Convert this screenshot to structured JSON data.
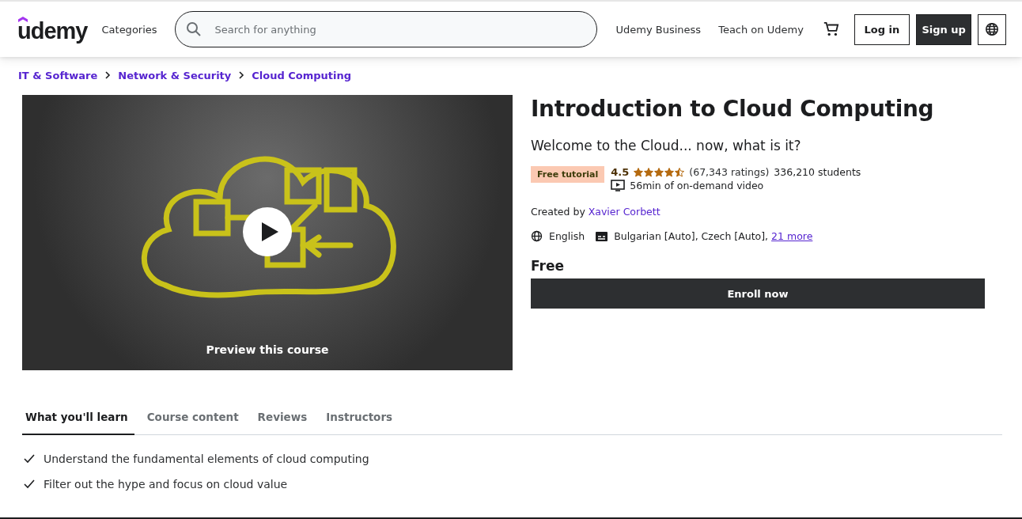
{
  "header": {
    "logo": "udemy",
    "categories": "Categories",
    "search": {
      "placeholder": "Search for anything"
    },
    "links": [
      "Udemy Business",
      "Teach on Udemy"
    ],
    "login": "Log in",
    "signup": "Sign up"
  },
  "breadcrumb": [
    "IT & Software",
    "Network & Security",
    "Cloud Computing"
  ],
  "preview": {
    "label": "Preview this course"
  },
  "course": {
    "title": "Introduction to Cloud Computing",
    "subtitle": "Welcome to the Cloud... now, what is it?",
    "badge": "Free tutorial",
    "rating": "4.5",
    "stars": 4.5,
    "ratings": "(67,343 ratings)",
    "students": "336,210 students",
    "video": "56min of on-demand video",
    "created_by": "Created by",
    "author": "Xavier Corbett",
    "language": "English",
    "captions": "Bulgarian [Auto], Czech [Auto],",
    "captions_more": "21 more",
    "price": "Free",
    "enroll": "Enroll now"
  },
  "tabs": [
    {
      "label": "What you'll learn",
      "selected": true
    },
    {
      "label": "Course content",
      "selected": false
    },
    {
      "label": "Reviews",
      "selected": false
    },
    {
      "label": "Instructors",
      "selected": false
    }
  ],
  "learn": [
    "Understand the fundamental elements of cloud computing",
    "Filter out the hype and focus on cloud value"
  ]
}
